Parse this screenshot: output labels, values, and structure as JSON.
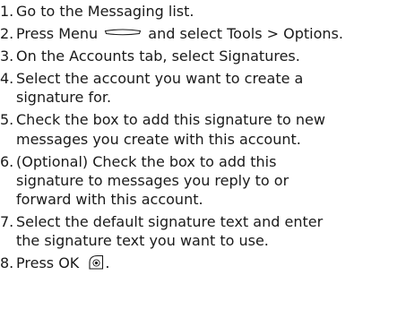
{
  "steps": [
    {
      "number": "1.",
      "lines": [
        "Go to the Messaging list."
      ]
    },
    {
      "number": "2.",
      "before_icon": "Press Menu ",
      "icon": "menu-key-icon",
      "after_icon": " and select Tools > Options."
    },
    {
      "number": "3.",
      "lines": [
        "On the Accounts tab, select Signatures."
      ]
    },
    {
      "number": "4.",
      "lines": [
        "Select the account you want to create a",
        "signature for."
      ]
    },
    {
      "number": "5.",
      "lines": [
        "Check the box to add this signature to new",
        "messages you create with this account."
      ]
    },
    {
      "number": "6.",
      "lines": [
        "(Optional) Check the box to add this",
        "signature to messages you reply to or",
        "forward with this account."
      ]
    },
    {
      "number": "7.",
      "lines": [
        "Select the default signature text and enter",
        "the signature text you want to use."
      ]
    },
    {
      "number": "8.",
      "before_icon": "Press OK ",
      "icon": "ok-key-icon",
      "after_icon": "."
    }
  ],
  "colors": {
    "text": "#1a1a1a",
    "background": "#ffffff"
  }
}
